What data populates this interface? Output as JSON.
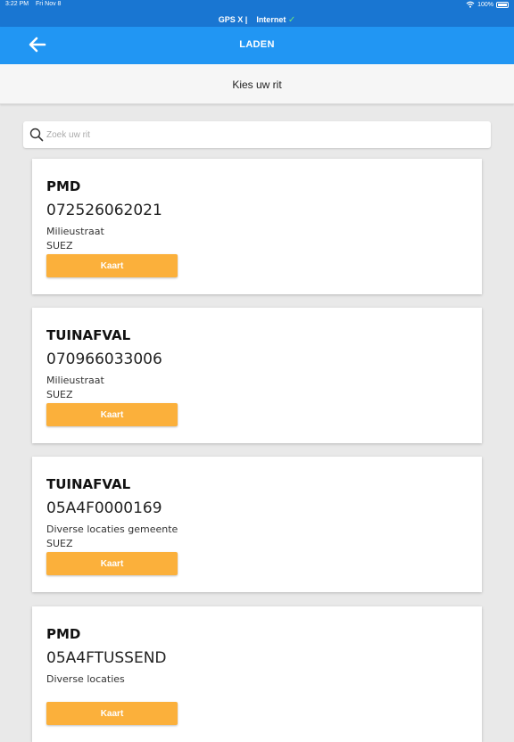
{
  "status_bar": {
    "time": "3:22 PM",
    "date": "Fri Nov 8",
    "battery": "100%",
    "gps": "GPS X |",
    "internet": "Internet",
    "check": "✓"
  },
  "app_bar": {
    "title": "LADEN",
    "back_icon": "arrow-left-icon"
  },
  "subheader": {
    "text": "Kies uw rit"
  },
  "search": {
    "placeholder": "Zoek uw rit",
    "value": "",
    "icon": "search-icon"
  },
  "colors": {
    "primary": "#2196f3",
    "status": "#1976d2",
    "accent": "#fbb03b",
    "background": "#e9e9e9"
  },
  "rides": [
    {
      "type": "PMD",
      "code": "072526062021",
      "location": "Milieustraat",
      "company": "SUEZ",
      "button": "Kaart"
    },
    {
      "type": "TUINAFVAL",
      "code": "070966033006",
      "location": "Milieustraat",
      "company": "SUEZ",
      "button": "Kaart"
    },
    {
      "type": "TUINAFVAL",
      "code": "05A4F0000169",
      "location": "Diverse locaties gemeente",
      "company": "SUEZ",
      "button": "Kaart"
    },
    {
      "type": "PMD",
      "code": "05A4FTUSSEND",
      "location": "Diverse locaties",
      "company": "",
      "button": "Kaart"
    }
  ]
}
